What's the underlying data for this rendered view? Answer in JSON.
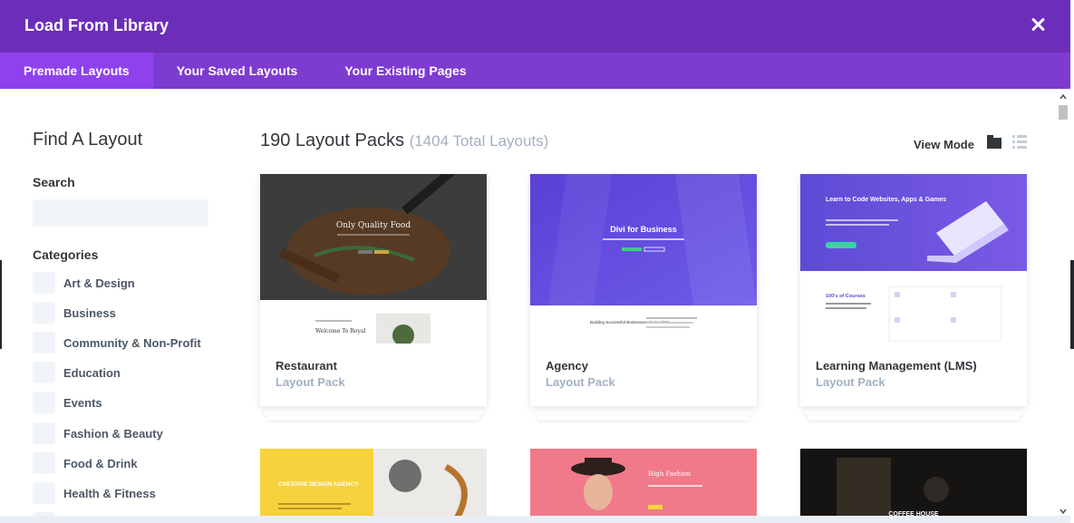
{
  "header": {
    "title": "Load From Library"
  },
  "tabs": [
    {
      "label": "Premade Layouts"
    },
    {
      "label": "Your Saved Layouts"
    },
    {
      "label": "Your Existing Pages"
    }
  ],
  "sidebar": {
    "heading": "Find A Layout",
    "search_label": "Search",
    "search_value": "",
    "categories_label": "Categories",
    "categories": [
      "Art & Design",
      "Business",
      "Community & Non-Profit",
      "Education",
      "Events",
      "Fashion & Beauty",
      "Food & Drink",
      "Health & Fitness"
    ]
  },
  "main": {
    "count": "190 Layout Packs",
    "total": "(1404 Total Layouts)",
    "view_mode": "View Mode",
    "packs": [
      {
        "name": "Restaurant",
        "type": "Layout Pack"
      },
      {
        "name": "Agency",
        "type": "Layout Pack"
      },
      {
        "name": "Learning Management (LMS)",
        "type": "Layout Pack"
      }
    ],
    "thumb_text": {
      "restaurant_hero": "Only Quality Food",
      "restaurant_welcome": "Welcome To Royal",
      "agency_hero": "Divi for Business",
      "agency_sub": "Building Successful Businesses Since 1969",
      "lms_hero": "Learn to Code Websites, Apps & Games",
      "lms_courses": "100's of Courses",
      "creative": "CREATIVE DESIGN AGENCY",
      "fashion": "High Fashion",
      "coffee": "COFFEE HOUSE"
    }
  }
}
